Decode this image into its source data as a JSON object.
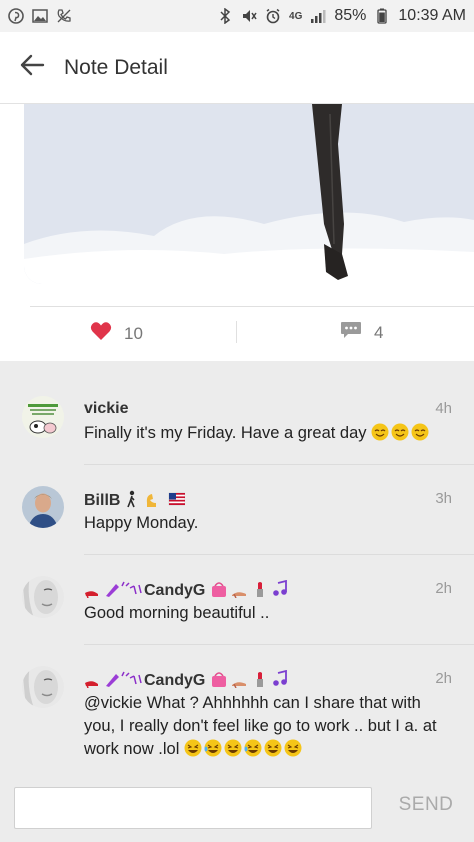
{
  "status_bar": {
    "battery": "85%",
    "time": "10:39 AM",
    "network": "4G",
    "left_icons": [
      "pinterest-icon",
      "image-icon",
      "phone-off-icon"
    ],
    "right_icons": [
      "bluetooth-icon",
      "mute-icon",
      "alarm-icon",
      "signal-icon",
      "battery-icon"
    ]
  },
  "header": {
    "title": "Note Detail",
    "back_icon": "arrow-left-icon"
  },
  "actions": {
    "likes": "10",
    "comments": "4",
    "like_color": "#e0344a"
  },
  "comments": [
    {
      "name": "vickie",
      "time": "4h",
      "text": "Finally it's my Friday.   Have a great day"
    },
    {
      "name": "BillB",
      "time": "3h",
      "text": "Happy Monday."
    },
    {
      "name": "CandyG",
      "time": "2h",
      "text": "Good morning  beautiful .."
    },
    {
      "name": "CandyG",
      "time": "2h",
      "text": "@vickie What ? Ahhhhhh can I share that with you,  I  really don't  feel like go to work .. but I a. at work now .lol"
    }
  ],
  "composer": {
    "placeholder": "",
    "send_label": "SEND"
  },
  "colors": {
    "accent": "#e0344a",
    "muted": "#9a9a9a",
    "background": "#ececec"
  }
}
